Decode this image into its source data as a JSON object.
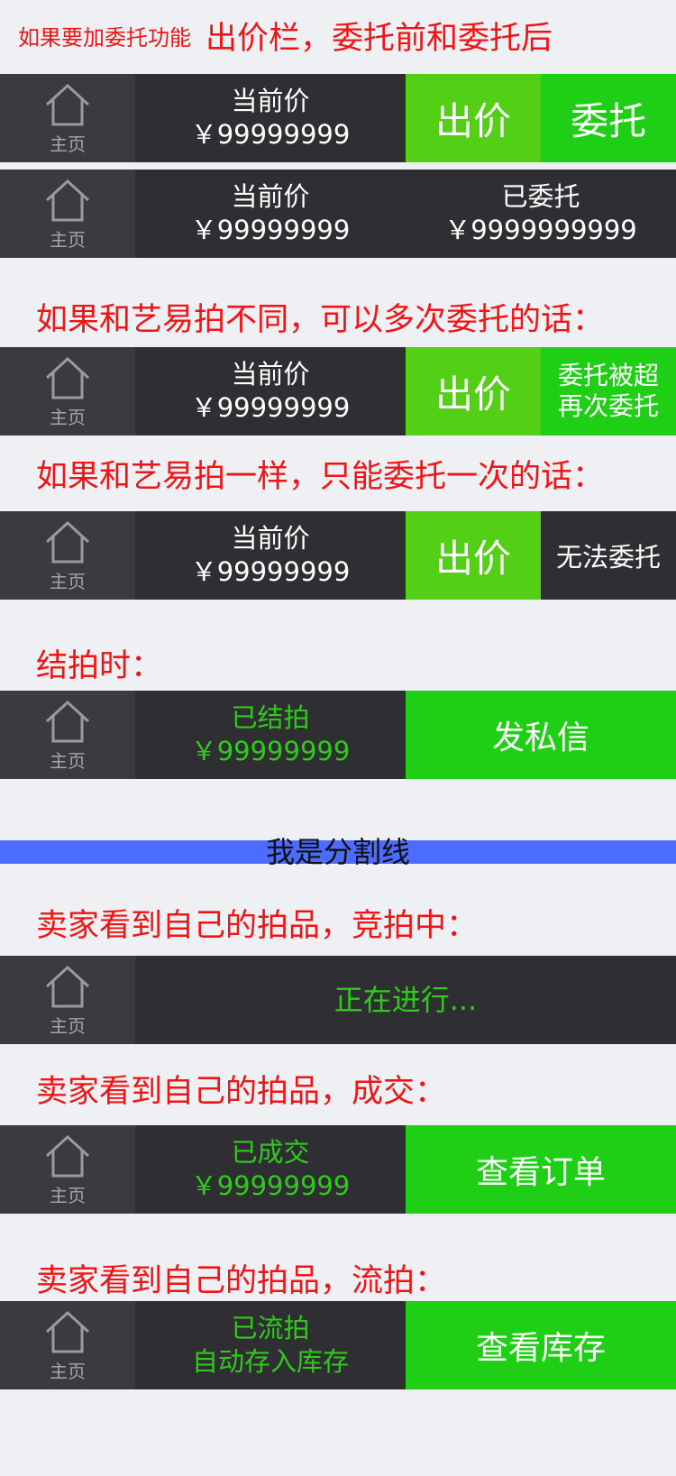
{
  "header": {
    "small_note": "如果要加委托功能",
    "big_note": "出价栏，委托前和委托后"
  },
  "home": {
    "label": "主页"
  },
  "rows": {
    "r1": {
      "price_label": "当前价",
      "price_value": "￥99999999",
      "bid_label": "出价",
      "entrust_label": "委托"
    },
    "r2": {
      "price_label": "当前价",
      "price_value": "￥99999999",
      "entrusted_label": "已委托",
      "entrusted_value": "￥9999999999"
    },
    "r3": {
      "price_label": "当前价",
      "price_value": "￥99999999",
      "bid_label": "出价",
      "reentrust_line1": "委托被超",
      "reentrust_line2": "再次委托"
    },
    "r4": {
      "price_label": "当前价",
      "price_value": "￥99999999",
      "bid_label": "出价",
      "cannot_label": "无法委托"
    },
    "r5": {
      "status": "已结拍",
      "price_value": "￥99999999",
      "action": "发私信"
    },
    "r6": {
      "status": "正在进行..."
    },
    "r7": {
      "status": "已成交",
      "price_value": "￥99999999",
      "action": "查看订单"
    },
    "r8": {
      "status": "已流拍",
      "sub": "自动存入库存",
      "action": "查看库存"
    }
  },
  "notes": {
    "multi_entrust": "如果和艺易拍不同，可以多次委托的话：",
    "single_entrust": "如果和艺易拍一样，只能委托一次的话：",
    "ended": "结拍时：",
    "seller_ongoing": "卖家看到自己的拍品，竞拍中：",
    "seller_deal": "卖家看到自己的拍品，成交：",
    "seller_unsold": "卖家看到自己的拍品，流拍："
  },
  "divider": {
    "label": "我是分割线"
  },
  "colors": {
    "bid_green": "#53d016",
    "action_green": "#1fcf16",
    "divider_blue": "#4c6bff",
    "note_red": "#f01414"
  }
}
